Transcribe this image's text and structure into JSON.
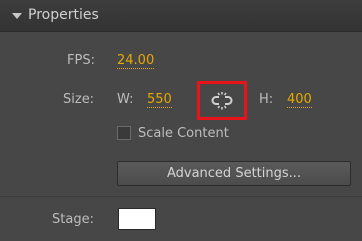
{
  "panel": {
    "title": "Properties"
  },
  "fps": {
    "label": "FPS:",
    "value": "24.00"
  },
  "size": {
    "label": "Size:",
    "width_label": "W:",
    "width_value": "550",
    "height_label": "H:",
    "height_value": "400",
    "link_icon": "chain-link-icon"
  },
  "scale_content": {
    "label": "Scale Content",
    "checked": false
  },
  "advanced_settings": {
    "label": "Advanced Settings..."
  },
  "stage": {
    "label": "Stage:",
    "color": "#ffffff"
  },
  "colors": {
    "value_accent": "#e6a800",
    "highlight": "#e8141a"
  }
}
